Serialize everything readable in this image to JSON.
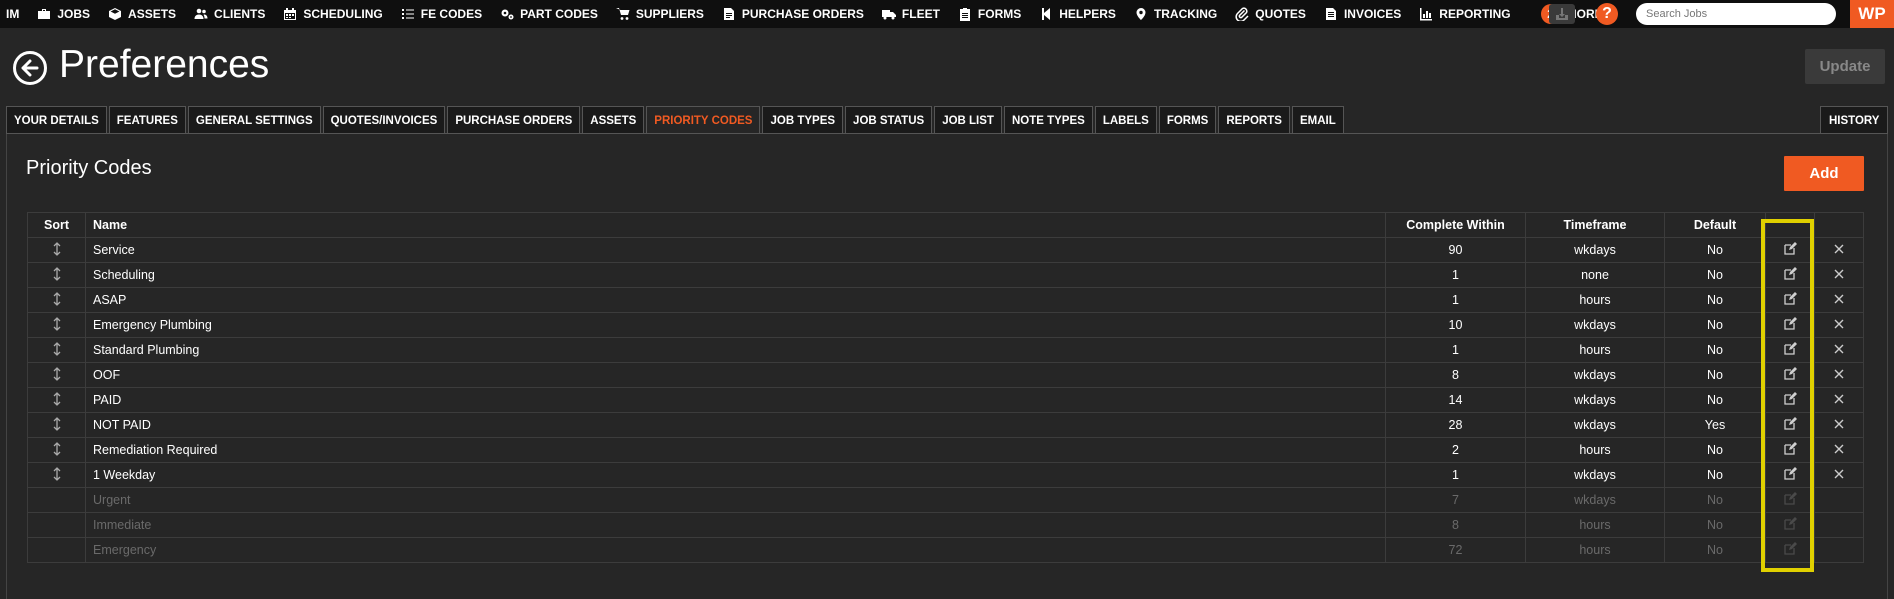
{
  "nav": {
    "items": [
      {
        "label": "IM",
        "icon": ""
      },
      {
        "label": "JOBS",
        "icon": "briefcase-icon"
      },
      {
        "label": "ASSETS",
        "icon": "cube-icon"
      },
      {
        "label": "CLIENTS",
        "icon": "users-icon"
      },
      {
        "label": "SCHEDULING",
        "icon": "calendar-icon"
      },
      {
        "label": "FE CODES",
        "icon": "list-icon"
      },
      {
        "label": "PART CODES",
        "icon": "cogs-icon"
      },
      {
        "label": "SUPPLIERS",
        "icon": "cart-icon"
      },
      {
        "label": "PURCHASE ORDERS",
        "icon": "file-icon"
      },
      {
        "label": "FLEET",
        "icon": "truck-icon"
      },
      {
        "label": "FORMS",
        "icon": "clipboard-icon"
      },
      {
        "label": "HELPERS",
        "icon": "helpers-icon"
      },
      {
        "label": "TRACKING",
        "icon": "map-marker-icon"
      },
      {
        "label": "QUOTES",
        "icon": "paperclip-icon"
      },
      {
        "label": "INVOICES",
        "icon": "invoice-icon"
      },
      {
        "label": "REPORTING",
        "icon": "chart-icon"
      }
    ],
    "more_count": "2",
    "more_label": "MORE...",
    "help_label": "?",
    "search_placeholder": "Search Jobs",
    "logo_text": "WP"
  },
  "header": {
    "title": "Preferences",
    "update_label": "Update"
  },
  "tabs": [
    {
      "label": "YOUR DETAILS",
      "active": false
    },
    {
      "label": "FEATURES",
      "active": false
    },
    {
      "label": "GENERAL SETTINGS",
      "active": false
    },
    {
      "label": "QUOTES/INVOICES",
      "active": false
    },
    {
      "label": "PURCHASE ORDERS",
      "active": false
    },
    {
      "label": "ASSETS",
      "active": false
    },
    {
      "label": "PRIORITY CODES",
      "active": true
    },
    {
      "label": "JOB TYPES",
      "active": false
    },
    {
      "label": "JOB STATUS",
      "active": false
    },
    {
      "label": "JOB LIST",
      "active": false
    },
    {
      "label": "NOTE TYPES",
      "active": false
    },
    {
      "label": "LABELS",
      "active": false
    },
    {
      "label": "FORMS",
      "active": false
    },
    {
      "label": "REPORTS",
      "active": false
    },
    {
      "label": "EMAIL",
      "active": false
    }
  ],
  "history_label": "HISTORY",
  "section": {
    "title": "Priority Codes",
    "add_label": "Add"
  },
  "table": {
    "headers": [
      "Sort",
      "Name",
      "Complete Within",
      "Timeframe",
      "Default"
    ],
    "rows": [
      {
        "name": "Service",
        "complete_within": "90",
        "timeframe": "wkdays",
        "default": "No",
        "enabled": true
      },
      {
        "name": "Scheduling",
        "complete_within": "1",
        "timeframe": "none",
        "default": "No",
        "enabled": true
      },
      {
        "name": "ASAP",
        "complete_within": "1",
        "timeframe": "hours",
        "default": "No",
        "enabled": true
      },
      {
        "name": "Emergency Plumbing",
        "complete_within": "10",
        "timeframe": "wkdays",
        "default": "No",
        "enabled": true
      },
      {
        "name": "Standard Plumbing",
        "complete_within": "1",
        "timeframe": "hours",
        "default": "No",
        "enabled": true
      },
      {
        "name": "OOF",
        "complete_within": "8",
        "timeframe": "wkdays",
        "default": "No",
        "enabled": true
      },
      {
        "name": "PAID",
        "complete_within": "14",
        "timeframe": "wkdays",
        "default": "No",
        "enabled": true
      },
      {
        "name": "NOT PAID",
        "complete_within": "28",
        "timeframe": "wkdays",
        "default": "Yes",
        "enabled": true
      },
      {
        "name": "Remediation Required",
        "complete_within": "2",
        "timeframe": "hours",
        "default": "No",
        "enabled": true
      },
      {
        "name": "1 Weekday",
        "complete_within": "1",
        "timeframe": "wkdays",
        "default": "No",
        "enabled": true
      },
      {
        "name": "Urgent",
        "complete_within": "7",
        "timeframe": "wkdays",
        "default": "No",
        "enabled": false
      },
      {
        "name": "Immediate",
        "complete_within": "8",
        "timeframe": "hours",
        "default": "No",
        "enabled": false
      },
      {
        "name": "Emergency",
        "complete_within": "72",
        "timeframe": "hours",
        "default": "No",
        "enabled": false
      }
    ]
  },
  "colors": {
    "accent": "#f05a22",
    "highlight": "#e0d000",
    "nav_bg": "#0f0f0f",
    "page_bg": "#262626"
  }
}
